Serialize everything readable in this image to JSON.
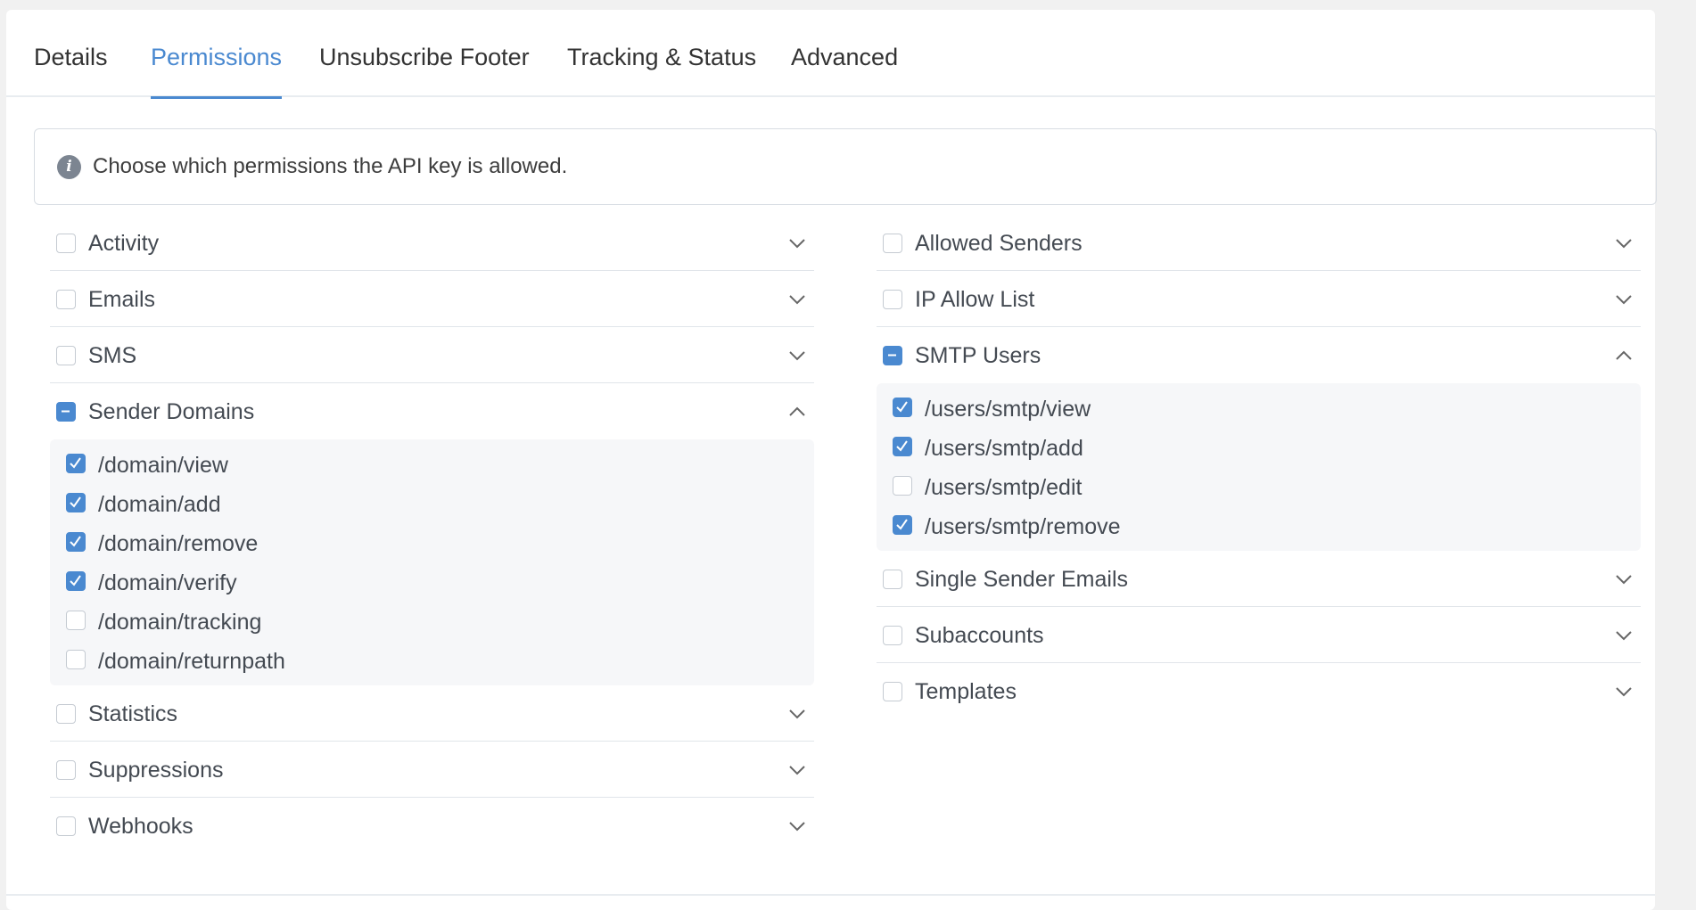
{
  "tabs": [
    {
      "label": "Details",
      "active": false
    },
    {
      "label": "Permissions",
      "active": true
    },
    {
      "label": "Unsubscribe Footer",
      "active": false
    },
    {
      "label": "Tracking & Status",
      "active": false
    },
    {
      "label": "Advanced",
      "active": false
    }
  ],
  "info": {
    "icon": "info-icon",
    "text": "Choose which permissions the API key is allowed."
  },
  "colors": {
    "accent": "#4a89d0",
    "text": "#444a52",
    "border": "#e1e5ea",
    "panel": "#f6f7f9"
  },
  "left_column": {
    "activity": {
      "label": "Activity",
      "state": "unchecked",
      "expanded": false
    },
    "emails": {
      "label": "Emails",
      "state": "unchecked",
      "expanded": false
    },
    "sms": {
      "label": "SMS",
      "state": "unchecked",
      "expanded": false
    },
    "sender_domains": {
      "label": "Sender Domains",
      "state": "partial",
      "expanded": true,
      "items": [
        {
          "label": "/domain/view",
          "checked": true
        },
        {
          "label": "/domain/add",
          "checked": true
        },
        {
          "label": "/domain/remove",
          "checked": true
        },
        {
          "label": "/domain/verify",
          "checked": true
        },
        {
          "label": "/domain/tracking",
          "checked": false
        },
        {
          "label": "/domain/returnpath",
          "checked": false
        }
      ]
    },
    "statistics": {
      "label": "Statistics",
      "state": "unchecked",
      "expanded": false
    },
    "suppressions": {
      "label": "Suppressions",
      "state": "unchecked",
      "expanded": false
    },
    "webhooks": {
      "label": "Webhooks",
      "state": "unchecked",
      "expanded": false
    }
  },
  "right_column": {
    "allowed_senders": {
      "label": "Allowed Senders",
      "state": "unchecked",
      "expanded": false
    },
    "ip_allow_list": {
      "label": "IP Allow List",
      "state": "unchecked",
      "expanded": false
    },
    "smtp_users": {
      "label": "SMTP Users",
      "state": "partial",
      "expanded": true,
      "items": [
        {
          "label": "/users/smtp/view",
          "checked": true
        },
        {
          "label": "/users/smtp/add",
          "checked": true
        },
        {
          "label": "/users/smtp/edit",
          "checked": false
        },
        {
          "label": "/users/smtp/remove",
          "checked": true
        }
      ]
    },
    "single_sender_emails": {
      "label": "Single Sender Emails",
      "state": "unchecked",
      "expanded": false
    },
    "subaccounts": {
      "label": "Subaccounts",
      "state": "unchecked",
      "expanded": false
    },
    "templates": {
      "label": "Templates",
      "state": "unchecked",
      "expanded": false
    }
  }
}
